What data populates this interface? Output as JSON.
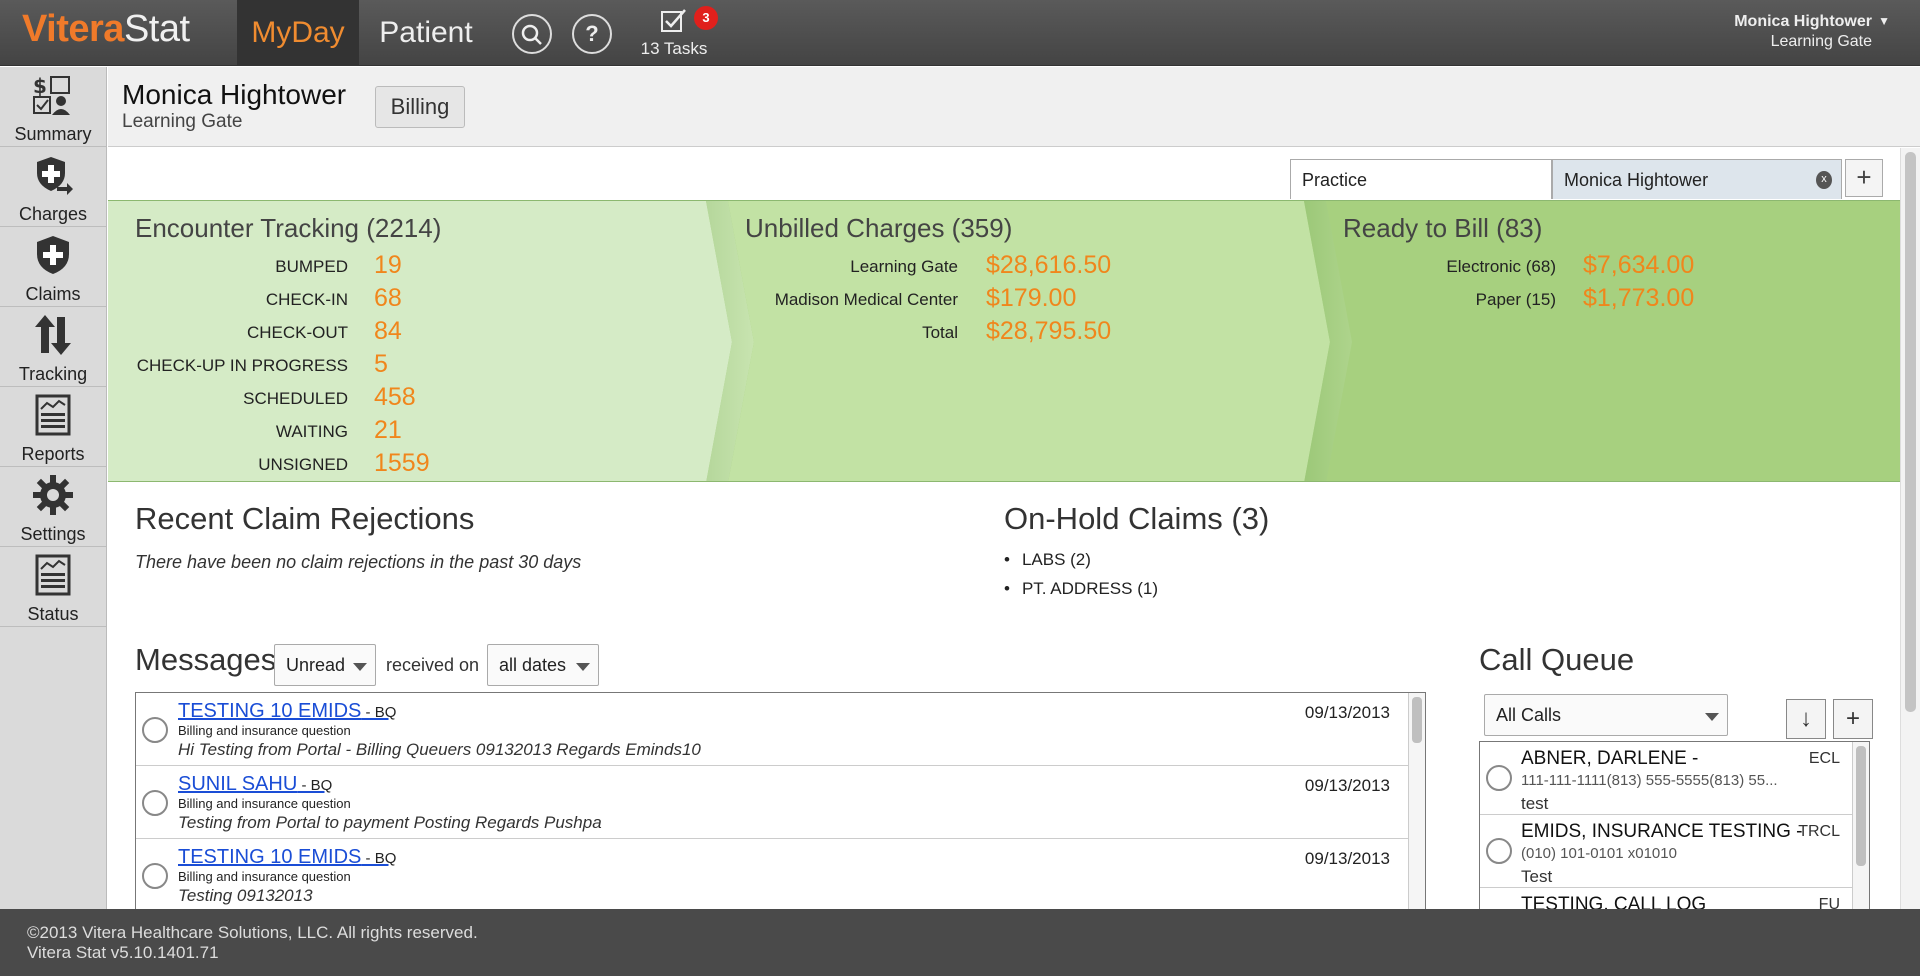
{
  "app": {
    "logo_brand": "Vitera",
    "logo_product": "Stat",
    "nav": {
      "myday": "MyDay",
      "patient": "Patient"
    },
    "help_glyph": "?",
    "tasks_badge": "3",
    "tasks_label": "13 Tasks",
    "user_name": "Monica Hightower",
    "user_location": "Learning Gate",
    "accent_color": "#f08c30"
  },
  "sidebar": {
    "items": [
      {
        "label": "Summary",
        "icon": "summary-icon"
      },
      {
        "label": "Charges",
        "icon": "charges-icon"
      },
      {
        "label": "Claims",
        "icon": "claims-icon"
      },
      {
        "label": "Tracking",
        "icon": "tracking-icon"
      },
      {
        "label": "Reports",
        "icon": "reports-icon"
      },
      {
        "label": "Settings",
        "icon": "gear-icon"
      },
      {
        "label": "Status",
        "icon": "status-icon"
      }
    ]
  },
  "subheader": {
    "name": "Monica Hightower",
    "location": "Learning Gate",
    "billing_button": "Billing"
  },
  "tabs": {
    "practice": "Practice",
    "monica": "Monica Hightower",
    "close_glyph": "x",
    "add_glyph": "+"
  },
  "encounter": {
    "title": "Encounter Tracking (2214)",
    "rows": [
      {
        "label": "BUMPED",
        "value": "19"
      },
      {
        "label": "CHECK-IN",
        "value": "68"
      },
      {
        "label": "CHECK-OUT",
        "value": "84"
      },
      {
        "label": "CHECK-UP IN PROGRESS",
        "value": "5"
      },
      {
        "label": "SCHEDULED",
        "value": "458"
      },
      {
        "label": "WAITING",
        "value": "21"
      },
      {
        "label": "UNSIGNED",
        "value": "1559"
      }
    ]
  },
  "unbilled": {
    "title": "Unbilled Charges (359)",
    "rows": [
      {
        "label": "Learning Gate",
        "value": "$28,616.50"
      },
      {
        "label": "Madison Medical Center",
        "value": "$179.00"
      },
      {
        "label": "Total",
        "value": "$28,795.50"
      }
    ]
  },
  "ready": {
    "title": "Ready to Bill (83)",
    "rows": [
      {
        "label": "Electronic (68)",
        "value": "$7,634.00"
      },
      {
        "label": "Paper (15)",
        "value": "$1,773.00"
      }
    ]
  },
  "rejections": {
    "title": "Recent Claim Rejections",
    "message": "There have been no claim rejections in the past 30 days"
  },
  "onhold": {
    "title": "On-Hold Claims (3)",
    "items": [
      "LABS (2)",
      "PT. ADDRESS (1)"
    ]
  },
  "messages": {
    "title": "Messages",
    "filter_status": "Unread",
    "received_on_label": "received on",
    "filter_dates": "all dates",
    "items": [
      {
        "sender": "TESTING 10 EMIDS",
        "source": " - BQ",
        "category": "Billing and insurance question",
        "body": "Hi Testing from Portal - Billing Queuers 09132013 Regards Eminds10",
        "date": "09/13/2013"
      },
      {
        "sender": "SUNIL SAHU",
        "source": " - BQ",
        "category": "Billing and insurance question",
        "body": "Testing from Portal to payment Posting Regards Pushpa",
        "date": "09/13/2013"
      },
      {
        "sender": "TESTING 10 EMIDS",
        "source": " - BQ",
        "category": "Billing and insurance question",
        "body": "Testing 09132013",
        "date": "09/13/2013"
      }
    ]
  },
  "callqueue": {
    "title": "Call Queue",
    "filter": "All Calls",
    "down_glyph": "↓",
    "add_glyph": "+",
    "items": [
      {
        "name": "ABNER, DARLENE -",
        "phone": "111-111-1111(813) 555-5555(813) 55...",
        "note": "test",
        "code": "ECL"
      },
      {
        "name": "EMIDS, INSURANCE TESTING -",
        "phone": "(010) 101-0101 x01010",
        "note": "Test",
        "code": "TRCL"
      },
      {
        "name": "TESTING, CALL LOG",
        "phone": "",
        "note": "",
        "code": "FU"
      }
    ]
  },
  "footer": {
    "copyright": "©2013 Vitera Healthcare Solutions, LLC. All rights reserved.",
    "version": "Vitera Stat v5.10.1401.71"
  }
}
